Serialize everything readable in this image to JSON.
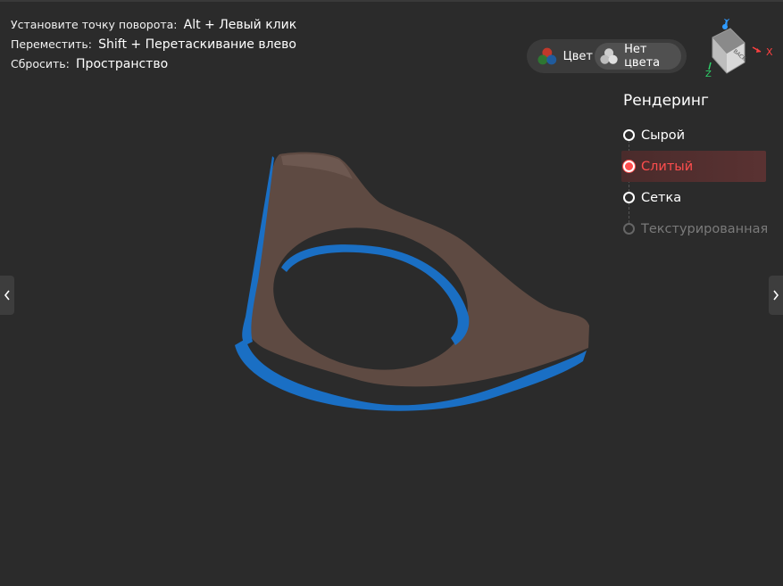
{
  "hints": [
    {
      "label": "Установите точку поворота:",
      "value": "Alt + Левый клик"
    },
    {
      "label": "Переместить:",
      "value": "Shift + Перетаскивание влево"
    },
    {
      "label": "Сбросить:",
      "value": "Пространство"
    }
  ],
  "color_toggle": {
    "color_label": "Цвет",
    "no_color_label": "Нет цвета",
    "selected": "no_color"
  },
  "orientation": {
    "cube_face": "BACK",
    "axis_x": "X",
    "axis_y": "Y",
    "axis_z": "Z",
    "colors": {
      "x": "#ff4040",
      "y": "#2f9bff",
      "z": "#2ed36a"
    }
  },
  "render": {
    "title": "Рендеринг",
    "options": [
      {
        "label": "Сырой",
        "state": "normal"
      },
      {
        "label": "Слитый",
        "state": "selected"
      },
      {
        "label": "Сетка",
        "state": "normal"
      },
      {
        "label": "Текстурированная",
        "state": "disabled"
      }
    ],
    "accent": "#ff4d4d"
  },
  "nav": {
    "left_icon": "chevron-left-icon",
    "right_icon": "chevron-right-icon"
  },
  "model_colors": {
    "body": "#5e4a42",
    "rim": "#1a6fc4"
  }
}
